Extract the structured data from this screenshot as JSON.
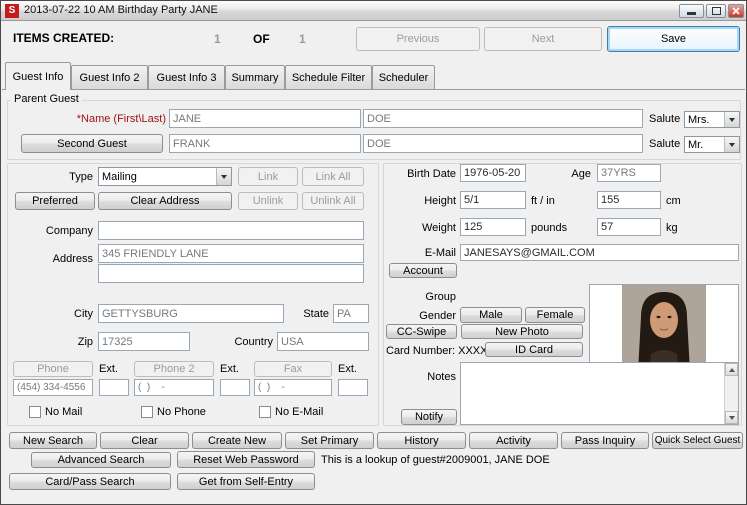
{
  "window": {
    "title": "2013-07-22 10 AM Birthday Party  JANE",
    "icon_letter": "S"
  },
  "header": {
    "items_created": "ITEMS CREATED:",
    "current": "1",
    "of": "OF",
    "total": "1",
    "previous": "Previous",
    "next": "Next",
    "save": "Save"
  },
  "tabs": {
    "guest_info": "Guest Info",
    "guest_info2": "Guest Info 2",
    "guest_info3": "Guest Info 3",
    "summary": "Summary",
    "schedule_filter": "Schedule Filter",
    "scheduler": "Scheduler"
  },
  "guest": {
    "section_label": "Parent Guest",
    "name_label": "*Name (First\\Last)",
    "first_name": "JANE",
    "last_name": "DOE",
    "salute_label": "Salute",
    "salute1": "Mrs.",
    "second_guest_button": "Second Guest",
    "second_first_name": "FRANK",
    "second_last_name": "DOE",
    "salute2": "Mr."
  },
  "address": {
    "type_label": "Type",
    "type_value": "Mailing",
    "link": "Link",
    "link_all": "Link All",
    "preferred": "Preferred",
    "clear_address": "Clear Address",
    "unlink": "Unlink",
    "unlink_all": "Unlink All",
    "company_label": "Company",
    "company": "",
    "address_label": "Address",
    "address1": "345 FRIENDLY LANE",
    "address2": "",
    "city_label": "City",
    "city": "GETTYSBURG",
    "state_label": "State",
    "state": "PA",
    "zip_label": "Zip",
    "zip": "17325",
    "country_label": "Country",
    "country": "USA"
  },
  "phones": {
    "phone_label": "Phone",
    "ext_label": "Ext.",
    "phone2_label": "Phone 2",
    "fax_label": "Fax",
    "phone_value": "(454) 334-4556",
    "phone_ext": "",
    "phone2_value": "(  )    -",
    "phone2_ext": "",
    "fax_value": "(  )    -",
    "fax_ext": "",
    "no_mail": "No Mail",
    "no_phone": "No Phone",
    "no_email": "No E-Mail"
  },
  "details": {
    "birth_date_label": "Birth Date",
    "birth_date": "1976-05-20",
    "age_label": "Age",
    "age": "37YRS",
    "height_label": "Height",
    "height_ftin": "5/1",
    "ftin_label": "ft / in",
    "height_cm": "155",
    "cm_label": "cm",
    "weight_label": "Weight",
    "weight_lb": "125",
    "pounds_label": "pounds",
    "weight_kg": "57",
    "kg_label": "kg",
    "email_label": "E-Mail",
    "email": "JANESAYS@GMAIL.COM",
    "account_button": "Account",
    "group_label": "Group",
    "gender_label": "Gender",
    "male_button": "Male",
    "female_button": "Female",
    "cc_swipe_button": "CC-Swipe",
    "new_photo_button": "New Photo",
    "card_number_label": "Card Number: XXXX",
    "id_card_button": "ID Card",
    "notes_label": "Notes",
    "notes": "",
    "notify_button": "Notify"
  },
  "footer": {
    "new_search": "New Search",
    "clear": "Clear",
    "create_new": "Create New",
    "set_primary": "Set Primary",
    "history": "History",
    "activity": "Activity",
    "pass_inquiry": "Pass Inquiry",
    "quick_select_guest": "Quick Select Guest",
    "advanced_search": "Advanced Search",
    "reset_web_password": "Reset Web Password",
    "lookup_text": "This is a lookup of guest#2009001, JANE DOE",
    "card_pass_search": "Card/Pass Search",
    "get_from_self_entry": "Get from Self-Entry"
  }
}
